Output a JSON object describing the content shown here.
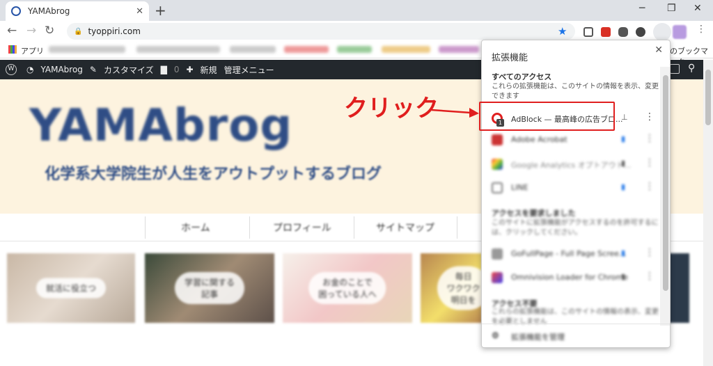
{
  "browser": {
    "tab_title": "YAMAbrog",
    "tab_close": "✕",
    "new_tab": "+",
    "url": "tyoppiri.com",
    "bookmarks_apps": "アプリ",
    "bookmarks_other": "のブックマーク"
  },
  "wp_admin": {
    "wp_label": "W",
    "site_name": "YAMAbrog",
    "customize": "カスタマイズ",
    "comments_count": "0",
    "new": "新規",
    "admin_menu": "管理メニュー"
  },
  "site": {
    "title": "YAMAbrog",
    "subtitle": "化学系大学院生が人生をアウトプットするブログ",
    "menu": [
      "ホーム",
      "プロフィール",
      "サイトマップ"
    ],
    "cards": [
      {
        "label": "就活に役立つ"
      },
      {
        "label": "学習に関する\n記事"
      },
      {
        "label": "お金のことで\n困っている人へ"
      },
      {
        "label": "毎日\nワクワク\n明日を"
      }
    ]
  },
  "extensions_popup": {
    "title": "拡張機能",
    "close": "✕",
    "section_full_access": "すべてのアクセス",
    "section_full_access_desc": "これらの拡張機能は、このサイトの情報を表示、変更できます",
    "adblock_name": "AdBlock — 最高峰の広告ブロ...",
    "adblock_badge": "1",
    "ext2_name": "Adobe Acrobat",
    "ext3_name": "Google Analytics オプトアウト...",
    "ext4_name": "LINE",
    "section_request": "アクセスを要求しました",
    "section_request_desc": "このサイトに拡張機能がアクセスするのを許可するには、クリックしてください。",
    "ext5_name": "GoFullPage - Full Page Scree...",
    "ext6_name": "Omnivision Loader for Chrome",
    "section_no_access": "アクセス不要",
    "section_no_access_desc": "これらの拡張機能は、このサイトの情報の表示、変更を必要としません",
    "footer": "拡張機能を管理"
  },
  "annotation": {
    "click_label": "クリック",
    "color": "#e01e1e"
  }
}
